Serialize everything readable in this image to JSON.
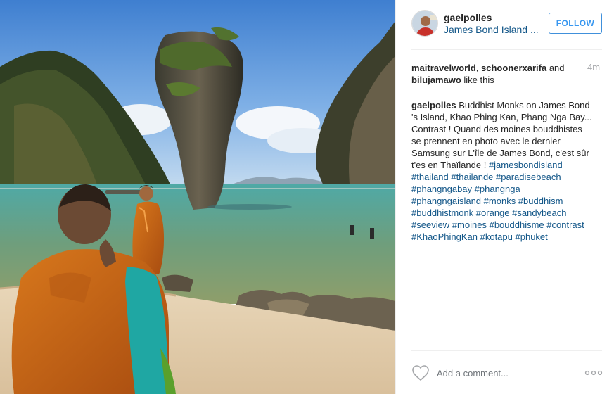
{
  "header": {
    "username": "gaelpolles",
    "location": "James Bond Island ...",
    "follow_label": "FOLLOW",
    "avatar_icon": "profile-avatar"
  },
  "likes": {
    "users": [
      "maitravelworld",
      "schoonerxarifa",
      "bilujamawo"
    ],
    "separator": ", ",
    "and_text": " and ",
    "suffix": " like this",
    "time": "4m"
  },
  "caption": {
    "username": "gaelpolles",
    "line1": " Buddhist Monks on James Bond",
    "line2": "'s Island, Khao Phing Kan, Phang Nga Bay...",
    "line3": "Contrast ! Quand des moines bouddhistes",
    "line4": "se prennent en photo avec le dernier",
    "line5": "Samsung sur L'île de James Bond, c'est sûr",
    "line6_text": "t'es en Thaïlande ! ",
    "hashtags": [
      "#jamesbondisland",
      "#thailand",
      "#thailande",
      "#paradisebeach",
      "#phangngabay",
      "#phangnga",
      "#phangngaisland",
      "#monks",
      "#buddhism",
      "#buddhistmonk",
      "#orange",
      "#sandybeach",
      "#seeview",
      "#moines",
      "#bouddhisme",
      "#contrast",
      "#KhaoPhingKan",
      "#kotapu",
      "#phuket"
    ]
  },
  "footer": {
    "comment_placeholder": "Add a comment...",
    "like_icon": "heart-icon",
    "more_icon": "more-options-icon"
  },
  "colors": {
    "link_blue": "#125688",
    "follow_blue": "#3897f0",
    "text": "#262626",
    "muted": "#a5a7aa"
  }
}
